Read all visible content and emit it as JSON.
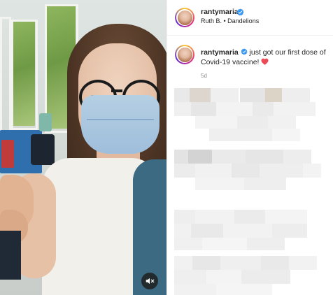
{
  "post": {
    "username": "rantymaria",
    "location": "Ruth B. • Dandelions",
    "caption_user": "rantymaria",
    "caption_text": "just got our first dose of Covid-19 vaccine!",
    "time_ago": "5d"
  },
  "colors": {
    "verified_blue": "#3897f0",
    "heart_red": "#ed4956",
    "text": "#262626",
    "muted": "#8e8e8e"
  },
  "icons": {
    "verified": "verified-badge-icon",
    "heart": "red-heart-icon",
    "mute": "speaker-muted-icon"
  }
}
